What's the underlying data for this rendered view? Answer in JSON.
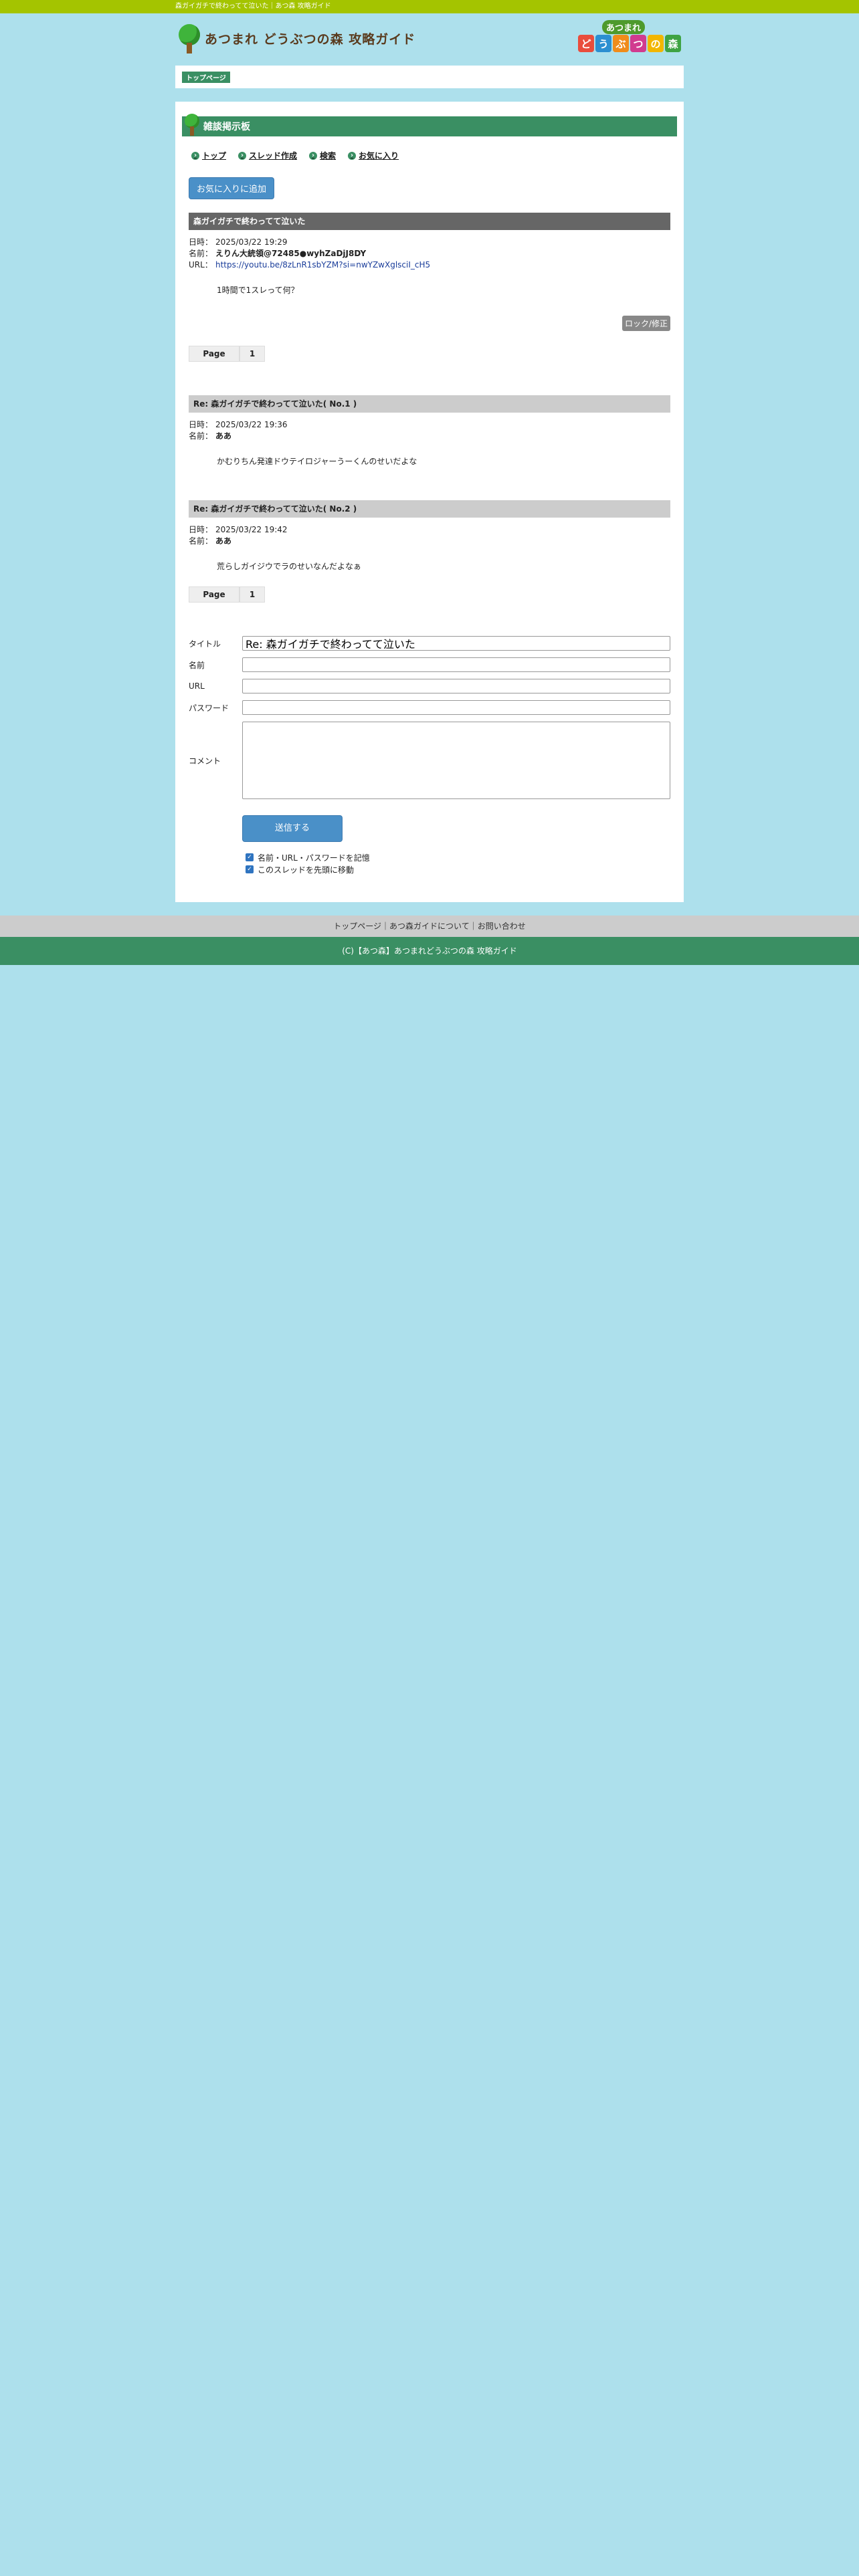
{
  "topbar": {
    "text": "森ガイガチで終わってて泣いた｜あつ森 攻略ガイド"
  },
  "header": {
    "logo_text": "あつまれ どうぶつの森 攻略ガイド",
    "logo_right_top": "あつまれ",
    "logo_right_tiles": [
      "ど",
      "う",
      "ぶ",
      "つ",
      "の",
      "森"
    ],
    "logo_right_colors": [
      "#e94d3c",
      "#2c8fd1",
      "#f08c1a",
      "#d13b8f",
      "#f2b600",
      "#3fa343"
    ]
  },
  "breadcrumb": {
    "home": "トップページ"
  },
  "board": {
    "title": "雑談掲示板",
    "nav": [
      "トップ",
      "スレッド作成",
      "検索",
      "お気に入り"
    ],
    "favorite_button": "お気に入りに追加"
  },
  "thread": {
    "title": "森ガイガチで終わってて泣いた",
    "date_label": "日時：",
    "date": "2025/03/22 19:29",
    "name_label": "名前：",
    "name": "えりん大統領@72485●wyhZaDjJ8DY",
    "url_label": "URL：",
    "url": "https://youtu.be/8zLnR1sbYZM?si=nwYZwXglsciI_cH5",
    "body": "1時間で1スレって何？",
    "lock_button": "ロック/修正"
  },
  "pager": {
    "label": "Page",
    "page": "1"
  },
  "replies": [
    {
      "title": "Re: 森ガイガチで終わってて泣いた( No.1 )",
      "date_label": "日時：",
      "date": "2025/03/22 19:36",
      "name_label": "名前：",
      "name": "ああ",
      "body": "かむりちん発達ドウテイロジャーうーくんのせいだよな"
    },
    {
      "title": "Re: 森ガイガチで終わってて泣いた( No.2 )",
      "date_label": "日時：",
      "date": "2025/03/22 19:42",
      "name_label": "名前：",
      "name": "ああ",
      "body": "荒らしガイジウでラのせいなんだよなぁ"
    }
  ],
  "form": {
    "title_label": "タイトル",
    "title_value": "Re: 森ガイガチで終わってて泣いた",
    "name_label": "名前",
    "url_label": "URL",
    "password_label": "パスワード",
    "comment_label": "コメント",
    "submit": "送信する",
    "check1": "名前・URL・パスワードを記憶",
    "check2": "このスレッドを先頭に移動"
  },
  "footer": {
    "links": "トップページ｜あつ森ガイドについて｜お問い合わせ",
    "copyright": "(C)【あつ森】あつまれどうぶつの森 攻略ガイド"
  }
}
